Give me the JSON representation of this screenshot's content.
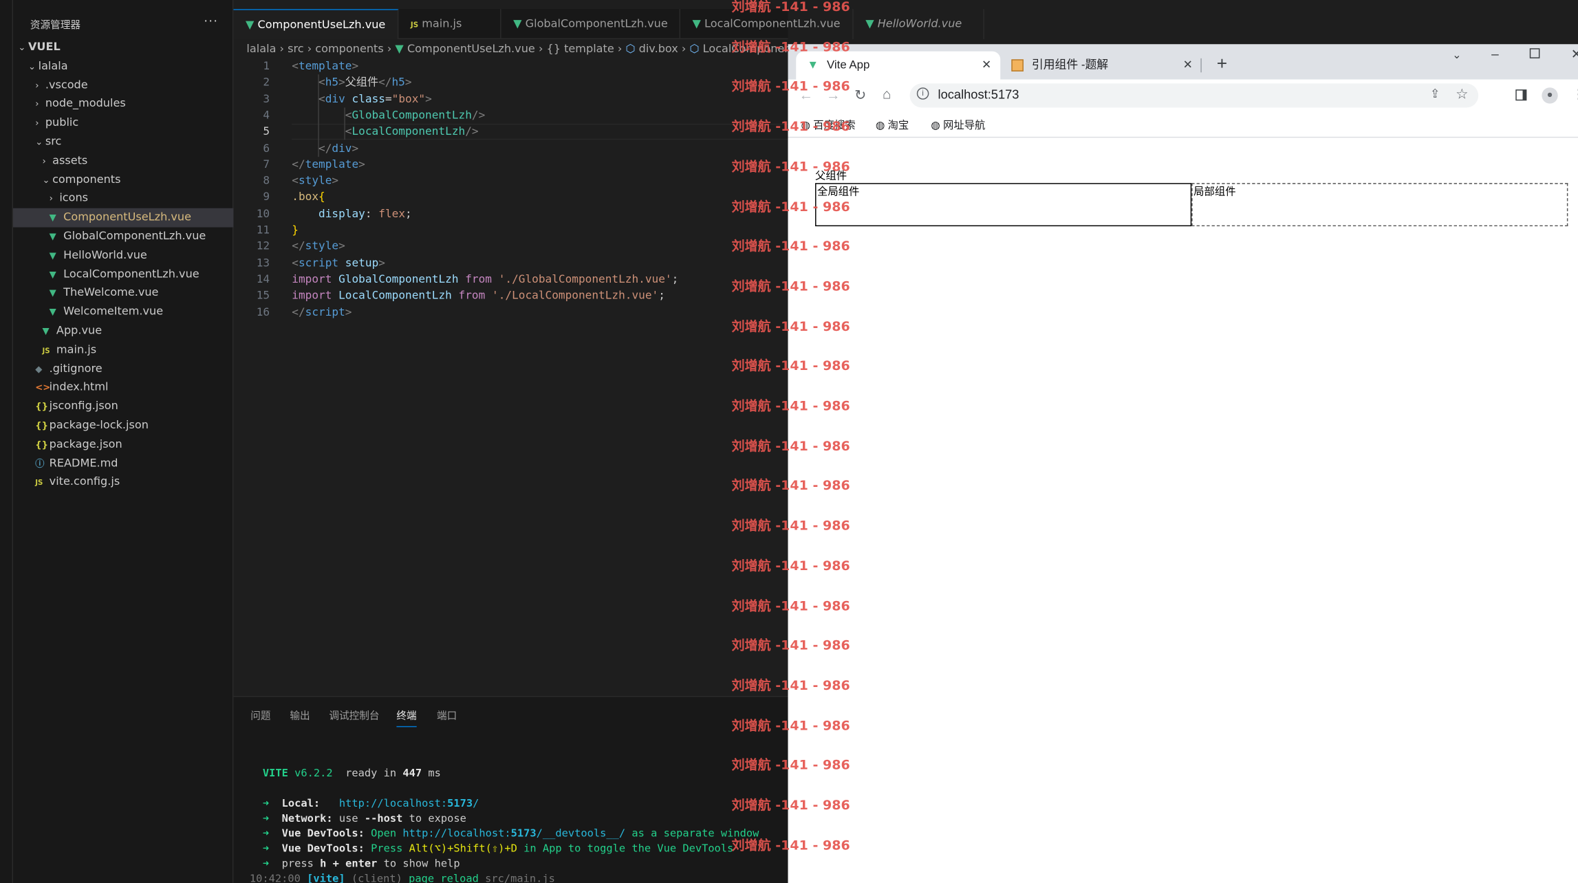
{
  "sidebar": {
    "title": "资源管理器",
    "more": "···",
    "items": [
      {
        "label": "VUEL",
        "icon": "chevron-down-icon",
        "depth": 0,
        "kind": "folder-root"
      },
      {
        "label": "lalala",
        "depth": 1,
        "kind": "folder-open"
      },
      {
        "label": ".vscode",
        "depth": 2,
        "kind": "folder"
      },
      {
        "label": "node_modules",
        "depth": 2,
        "kind": "folder"
      },
      {
        "label": "public",
        "depth": 2,
        "kind": "folder"
      },
      {
        "label": "src",
        "depth": 2,
        "kind": "folder-open"
      },
      {
        "label": "assets",
        "depth": 3,
        "kind": "folder"
      },
      {
        "label": "components",
        "depth": 3,
        "kind": "folder-open"
      },
      {
        "label": "icons",
        "depth": 4,
        "kind": "folder"
      },
      {
        "label": "ComponentUseLzh.vue",
        "depth": 4,
        "kind": "vue",
        "selected": true
      },
      {
        "label": "GlobalComponentLzh.vue",
        "depth": 4,
        "kind": "vue"
      },
      {
        "label": "HelloWorld.vue",
        "depth": 4,
        "kind": "vue"
      },
      {
        "label": "LocalComponentLzh.vue",
        "depth": 4,
        "kind": "vue"
      },
      {
        "label": "TheWelcome.vue",
        "depth": 4,
        "kind": "vue"
      },
      {
        "label": "WelcomeItem.vue",
        "depth": 4,
        "kind": "vue"
      },
      {
        "label": "App.vue",
        "depth": 3,
        "kind": "vue"
      },
      {
        "label": "main.js",
        "depth": 3,
        "kind": "js"
      },
      {
        "label": ".gitignore",
        "depth": 2,
        "kind": "git"
      },
      {
        "label": "index.html",
        "depth": 2,
        "kind": "html"
      },
      {
        "label": "jsconfig.json",
        "depth": 2,
        "kind": "json"
      },
      {
        "label": "package-lock.json",
        "depth": 2,
        "kind": "json"
      },
      {
        "label": "package.json",
        "depth": 2,
        "kind": "json"
      },
      {
        "label": "README.md",
        "depth": 2,
        "kind": "info"
      },
      {
        "label": "vite.config.js",
        "depth": 2,
        "kind": "js"
      }
    ]
  },
  "editor": {
    "tabs": [
      {
        "label": "ComponentUseLzh.vue",
        "active": true,
        "close": "✕"
      },
      {
        "label": "main.js"
      },
      {
        "label": "GlobalComponentLzh.vue"
      },
      {
        "label": "LocalComponentLzh.vue"
      },
      {
        "label": "HelloWorld.vue"
      }
    ],
    "breadcrumb": [
      "lalala",
      "src",
      "components",
      "ComponentUseLzh.vue",
      "{} template",
      "div.box",
      "LocalComponentLzh"
    ],
    "line_numbers": [
      "1",
      "2",
      "3",
      "4",
      "5",
      "6",
      "7",
      "8",
      "9",
      "10",
      "11",
      "12",
      "13",
      "14",
      "15",
      "16"
    ],
    "current_line": 5
  },
  "panel": {
    "tabs": [
      "问题",
      "输出",
      "调试控制台",
      "终端",
      "端口"
    ],
    "active_tab": "终端",
    "terminal": {
      "vite_name": "VITE",
      "vite_version": "v6.2.2",
      "ready_text": "ready in",
      "ready_ms": "447",
      "ms": "ms",
      "local_label": "Local:",
      "local_url_a": "http://localhost:",
      "local_url_port": "5173",
      "local_url_b": "/",
      "network_label": "Network:",
      "network_text_a": "use",
      "network_flag": "--host",
      "network_text_b": "to expose",
      "devtools_label": "Vue DevTools:",
      "devtools_open": "Open",
      "devtools_url_a": "http://localhost:",
      "devtools_url_port": "5173",
      "devtools_url_b": "/__devtools__/",
      "devtools_sep": "as a separate window",
      "devtools2_press": "Press",
      "devtools2_keys": "Alt(⌥)+Shift(⇧)+D",
      "devtools2_rest": "in App to toggle the Vue DevTools",
      "help_press": "press",
      "help_keys": "h + enter",
      "help_rest": "to show help",
      "last_time": "10:42:00",
      "last_tag": "[vite]",
      "last_client": "(client)",
      "last_msg": "page reload",
      "last_file": "src/main.js",
      "arrow": "➜"
    }
  },
  "browser": {
    "tabs": [
      {
        "label": "Vite App",
        "active": true,
        "icon": "vue-logo-icon"
      },
      {
        "label": "引用组件 -题解",
        "icon": "page-favicon-icon"
      }
    ],
    "new_tab": "+",
    "url": "localhost:5173",
    "bookmarks": [
      "百度搜索",
      "淘宝",
      "网址导航"
    ],
    "page": {
      "heading": "父组件",
      "global_component": "全局组件",
      "local_component": "局部组件"
    }
  },
  "watermark": {
    "name": "刘增航",
    "text": "-141 - 986"
  },
  "colors": {
    "editor_bg": "#1f1f1f",
    "sidebar_bg": "#181818",
    "accent": "#0078d4",
    "vue_green": "#41b883",
    "watermark_red": "#e6554f"
  }
}
